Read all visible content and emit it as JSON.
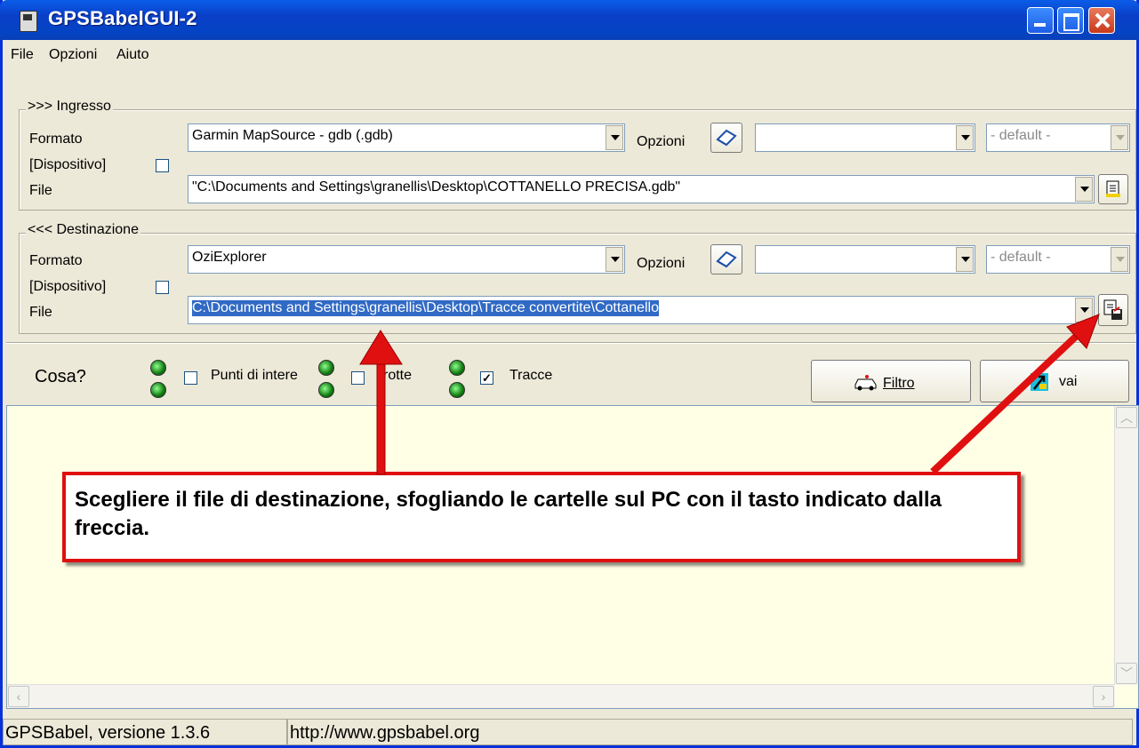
{
  "window": {
    "title": "GPSBabelGUI-2"
  },
  "menu": [
    "File",
    "Opzioni",
    "Aiuto"
  ],
  "input": {
    "legend": ">>> Ingresso",
    "format_label": "Formato",
    "device_label": "[Dispositivo]",
    "file_label": "File",
    "format_value": "Garmin MapSource - gdb (.gdb)",
    "options_label": "Opzioni",
    "options_value": "",
    "charset_value": "- default -",
    "file_value": "\"C:\\Documents and Settings\\granellis\\Desktop\\COTTANELLO PRECISA.gdb\""
  },
  "output": {
    "legend": "<<< Destinazione",
    "format_label": "Formato",
    "device_label": "[Dispositivo]",
    "file_label": "File",
    "format_value": "OziExplorer",
    "options_label": "Opzioni",
    "options_value": "",
    "charset_value": "- default -",
    "file_value": "C:\\Documents and Settings\\granellis\\Desktop\\Tracce convertite\\Cottanello"
  },
  "what": {
    "label": "Cosa?",
    "waypoints": {
      "label": "Punti di intere",
      "checked": false
    },
    "routes": {
      "label": "rotte",
      "checked": false
    },
    "tracks": {
      "label": "Tracce",
      "checked": true
    },
    "filter_button": "Filtro",
    "go_button": "vai"
  },
  "callout": {
    "text": "Scegliere il file di destinazione, sfogliando le cartelle sul PC con il tasto indicato dalla freccia.",
    "color": "#e01010"
  },
  "status": {
    "version": "GPSBabel, versione 1.3.6",
    "url": "http://www.gpsbabel.org"
  }
}
